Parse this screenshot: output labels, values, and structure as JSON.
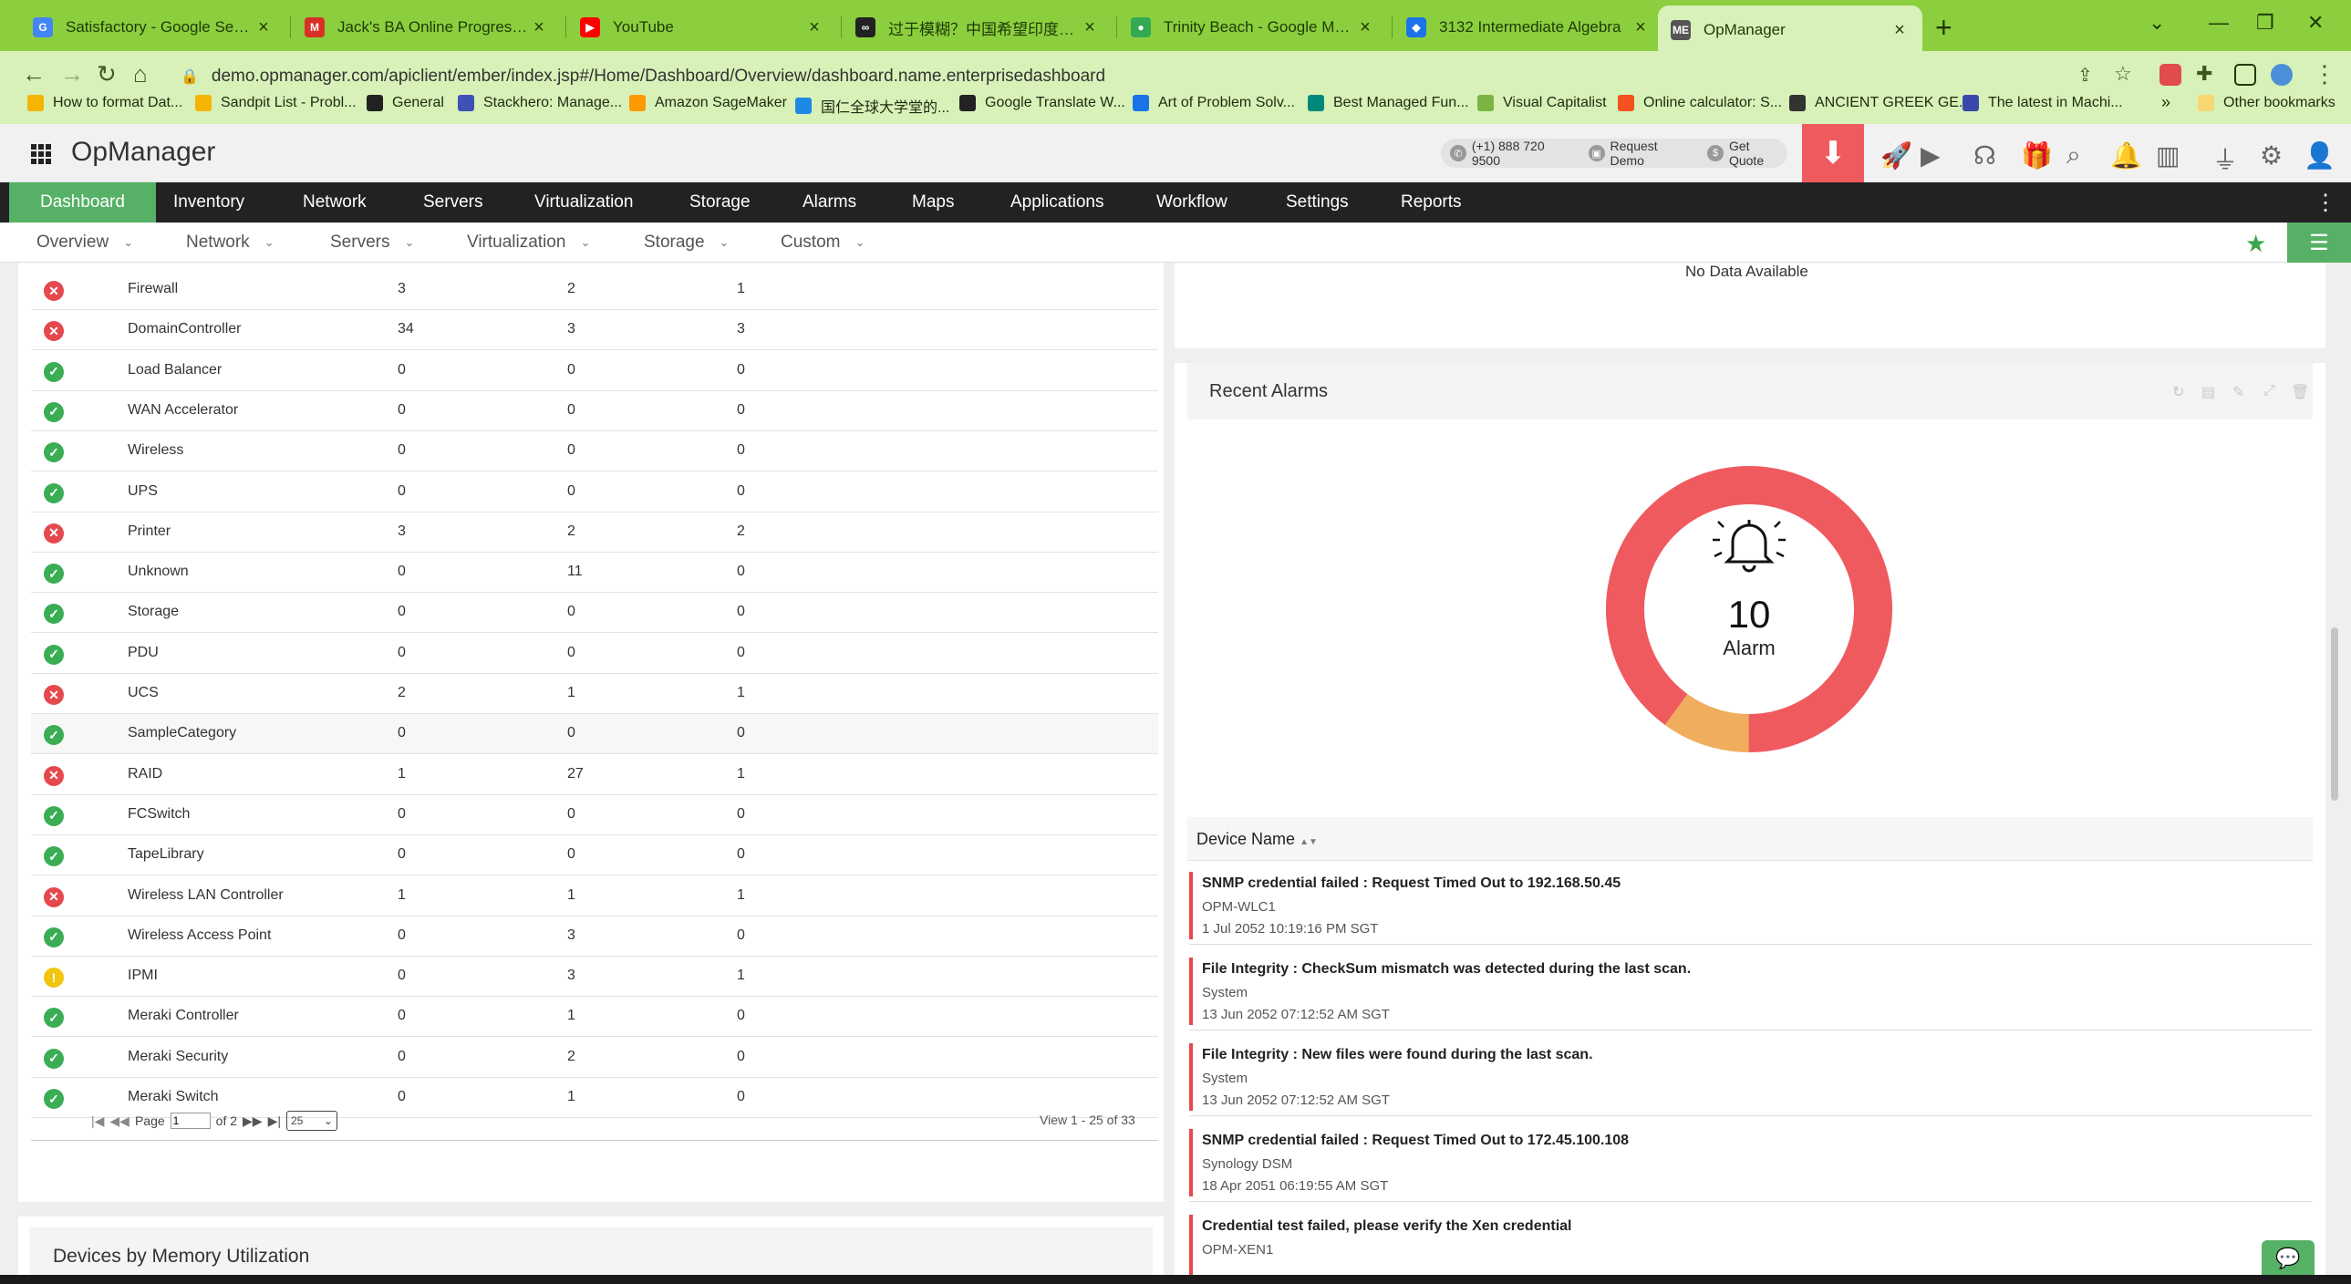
{
  "browser": {
    "tabs": [
      {
        "title": "Satisfactory - Google Search",
        "favicon": "google-icon",
        "color": "#4285f4",
        "glyph": "G"
      },
      {
        "title": "Jack's BA Online Progress: Aug 7",
        "favicon": "gmail-icon",
        "color": "#d93025",
        "glyph": "M"
      },
      {
        "title": "YouTube",
        "favicon": "youtube-icon",
        "color": "#ff0000",
        "glyph": "▶"
      },
      {
        "title": "过于模糊？中国希望印度重申\"一...",
        "favicon": "news-icon",
        "color": "#222222",
        "glyph": "∞"
      },
      {
        "title": "Trinity Beach - Google Maps",
        "favicon": "maps-icon",
        "color": "#34a853",
        "glyph": "●"
      },
      {
        "title": "3132 Intermediate Algebra",
        "favicon": "course-icon",
        "color": "#1a73e8",
        "glyph": "◆"
      },
      {
        "title": "OpManager",
        "favicon": "opmanager-icon",
        "color": "#555555",
        "glyph": "ME"
      }
    ],
    "url": "demo.opmanager.com/apiclient/ember/index.jsp#/Home/Dashboard/Overview/dashboard.name.enterprisedashboard",
    "bookmarks": [
      {
        "label": "How to format Dat...",
        "color": "#f4b400"
      },
      {
        "label": "Sandpit List - Probl...",
        "color": "#f4b400"
      },
      {
        "label": "General",
        "color": "#222222"
      },
      {
        "label": "Stackhero: Manage...",
        "color": "#3f51b5"
      },
      {
        "label": "Amazon SageMaker",
        "color": "#ff9900"
      },
      {
        "label": "国仁全球大学堂的...",
        "color": "#1e88e5"
      },
      {
        "label": "Google Translate W...",
        "color": "#222222"
      },
      {
        "label": "Art of Problem Solv...",
        "color": "#1a73e8"
      },
      {
        "label": "Best Managed Fun...",
        "color": "#00897b"
      },
      {
        "label": "Visual Capitalist",
        "color": "#7cb342"
      },
      {
        "label": "Online calculator: S...",
        "color": "#f4511e"
      },
      {
        "label": "ANCIENT GREEK GE...",
        "color": "#333333"
      },
      {
        "label": "The latest in Machi...",
        "color": "#3949ab"
      }
    ],
    "bookmarks_more": "»",
    "other_bookmarks": "Other bookmarks"
  },
  "app": {
    "brand": "OpManager",
    "phone": "(+1) 888 720 9500",
    "request_demo": "Request Demo",
    "get_quote": "Get Quote",
    "accent_color": "#56b166",
    "alert_color": "#ef5a5f"
  },
  "nav": {
    "main": [
      "Dashboard",
      "Inventory",
      "Network",
      "Servers",
      "Virtualization",
      "Storage",
      "Alarms",
      "Maps",
      "Applications",
      "Workflow",
      "Settings",
      "Reports"
    ],
    "active": "Dashboard",
    "sub": [
      "Overview",
      "Network",
      "Servers",
      "Virtualization",
      "Storage",
      "Custom"
    ]
  },
  "device_table": {
    "rows": [
      {
        "status": "critical",
        "name": "Firewall",
        "c1": "3",
        "c2": "2",
        "c3": "1"
      },
      {
        "status": "critical",
        "name": "DomainController",
        "c1": "34",
        "c2": "3",
        "c3": "3"
      },
      {
        "status": "ok",
        "name": "Load Balancer",
        "c1": "0",
        "c2": "0",
        "c3": "0"
      },
      {
        "status": "ok",
        "name": "WAN Accelerator",
        "c1": "0",
        "c2": "0",
        "c3": "0"
      },
      {
        "status": "ok",
        "name": "Wireless",
        "c1": "0",
        "c2": "0",
        "c3": "0"
      },
      {
        "status": "ok",
        "name": "UPS",
        "c1": "0",
        "c2": "0",
        "c3": "0"
      },
      {
        "status": "critical",
        "name": "Printer",
        "c1": "3",
        "c2": "2",
        "c3": "2"
      },
      {
        "status": "ok",
        "name": "Unknown",
        "c1": "0",
        "c2": "11",
        "c3": "0"
      },
      {
        "status": "ok",
        "name": "Storage",
        "c1": "0",
        "c2": "0",
        "c3": "0"
      },
      {
        "status": "ok",
        "name": "PDU",
        "c1": "0",
        "c2": "0",
        "c3": "0"
      },
      {
        "status": "critical",
        "name": "UCS",
        "c1": "2",
        "c2": "1",
        "c3": "1"
      },
      {
        "status": "ok",
        "name": "SampleCategory",
        "c1": "0",
        "c2": "0",
        "c3": "0"
      },
      {
        "status": "critical",
        "name": "RAID",
        "c1": "1",
        "c2": "27",
        "c3": "1"
      },
      {
        "status": "ok",
        "name": "FCSwitch",
        "c1": "0",
        "c2": "0",
        "c3": "0"
      },
      {
        "status": "ok",
        "name": "TapeLibrary",
        "c1": "0",
        "c2": "0",
        "c3": "0"
      },
      {
        "status": "critical",
        "name": "Wireless LAN Controller",
        "c1": "1",
        "c2": "1",
        "c3": "1"
      },
      {
        "status": "ok",
        "name": "Wireless Access Point",
        "c1": "0",
        "c2": "3",
        "c3": "0"
      },
      {
        "status": "warning",
        "name": "IPMI",
        "c1": "0",
        "c2": "3",
        "c3": "1"
      },
      {
        "status": "ok",
        "name": "Meraki Controller",
        "c1": "0",
        "c2": "1",
        "c3": "0"
      },
      {
        "status": "ok",
        "name": "Meraki Security",
        "c1": "0",
        "c2": "2",
        "c3": "0"
      },
      {
        "status": "ok",
        "name": "Meraki Switch",
        "c1": "0",
        "c2": "1",
        "c3": "0"
      }
    ],
    "pager": {
      "page_label": "Page",
      "page_value": "1",
      "of_label": "of 2",
      "page_size": "25",
      "view_info": "View 1 - 25 of 33"
    }
  },
  "memory_widget": {
    "title": "Devices by Memory Utilization"
  },
  "top_right_widget": {
    "no_data": "No Data Available"
  },
  "recent_alarms": {
    "title": "Recent Alarms",
    "count": "10",
    "count_label": "Alarm",
    "donut": [
      {
        "label": "critical",
        "value": 9,
        "color": "#ef5a5f"
      },
      {
        "label": "trouble",
        "value": 1,
        "color": "#f0ad5e"
      }
    ],
    "column_header": "Device Name",
    "items": [
      {
        "message": "SNMP credential failed : Request Timed Out to 192.168.50.45",
        "device": "OPM-WLC1",
        "time": "1 Jul 2052 10:19:16 PM SGT"
      },
      {
        "message": "File Integrity : CheckSum mismatch was detected during the last scan.",
        "device": "System",
        "time": "13 Jun 2052 07:12:52 AM SGT"
      },
      {
        "message": "File Integrity : New files were found during the last scan.",
        "device": "System",
        "time": "13 Jun 2052 07:12:52 AM SGT"
      },
      {
        "message": "SNMP credential failed : Request Timed Out to 172.45.100.108",
        "device": "Synology DSM",
        "time": "18 Apr 2051 06:19:55 AM SGT"
      },
      {
        "message": "Credential test failed, please verify the Xen credential",
        "device": "OPM-XEN1",
        "time": ""
      }
    ]
  }
}
